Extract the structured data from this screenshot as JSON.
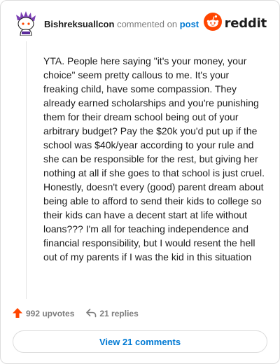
{
  "comment": {
    "username": "Bishreksuallcon",
    "action_text": "commented on",
    "target_link": "post",
    "brand": "reddit",
    "body": "YTA. People here saying \"it's your money, your choice\" seem pretty callous to me. It's your freaking child, have some compassion. They already earned scholarships and you're punishing them for their dream school being out of your arbitrary budget? Pay the $20k you'd put up if the school was $40k/year according to your rule and she can be responsible for the rest, but giving her nothing at all if she goes to that school is just cruel. Honestly, doesn't every (good) parent dream about being able to afford to send their kids to college so their kids can have a decent start at life without loans??? I'm all for teaching independence and financial responsibility, but I would resent the hell out of my parents if I was the kid in this situation",
    "upvotes_label": "992 upvotes",
    "replies_label": "21 replies",
    "view_comments_label": "View 21 comments"
  },
  "icons": {
    "avatar": "snoo-avatar-icon",
    "logo": "reddit-alien-icon",
    "upvote": "upvote-arrow-icon",
    "reply": "reply-arrow-icon"
  },
  "colors": {
    "brand": "#ff4500",
    "link": "#0079d3",
    "text": "#1c1c1c",
    "muted": "#7c7c7c",
    "border": "#dcdcdc"
  }
}
